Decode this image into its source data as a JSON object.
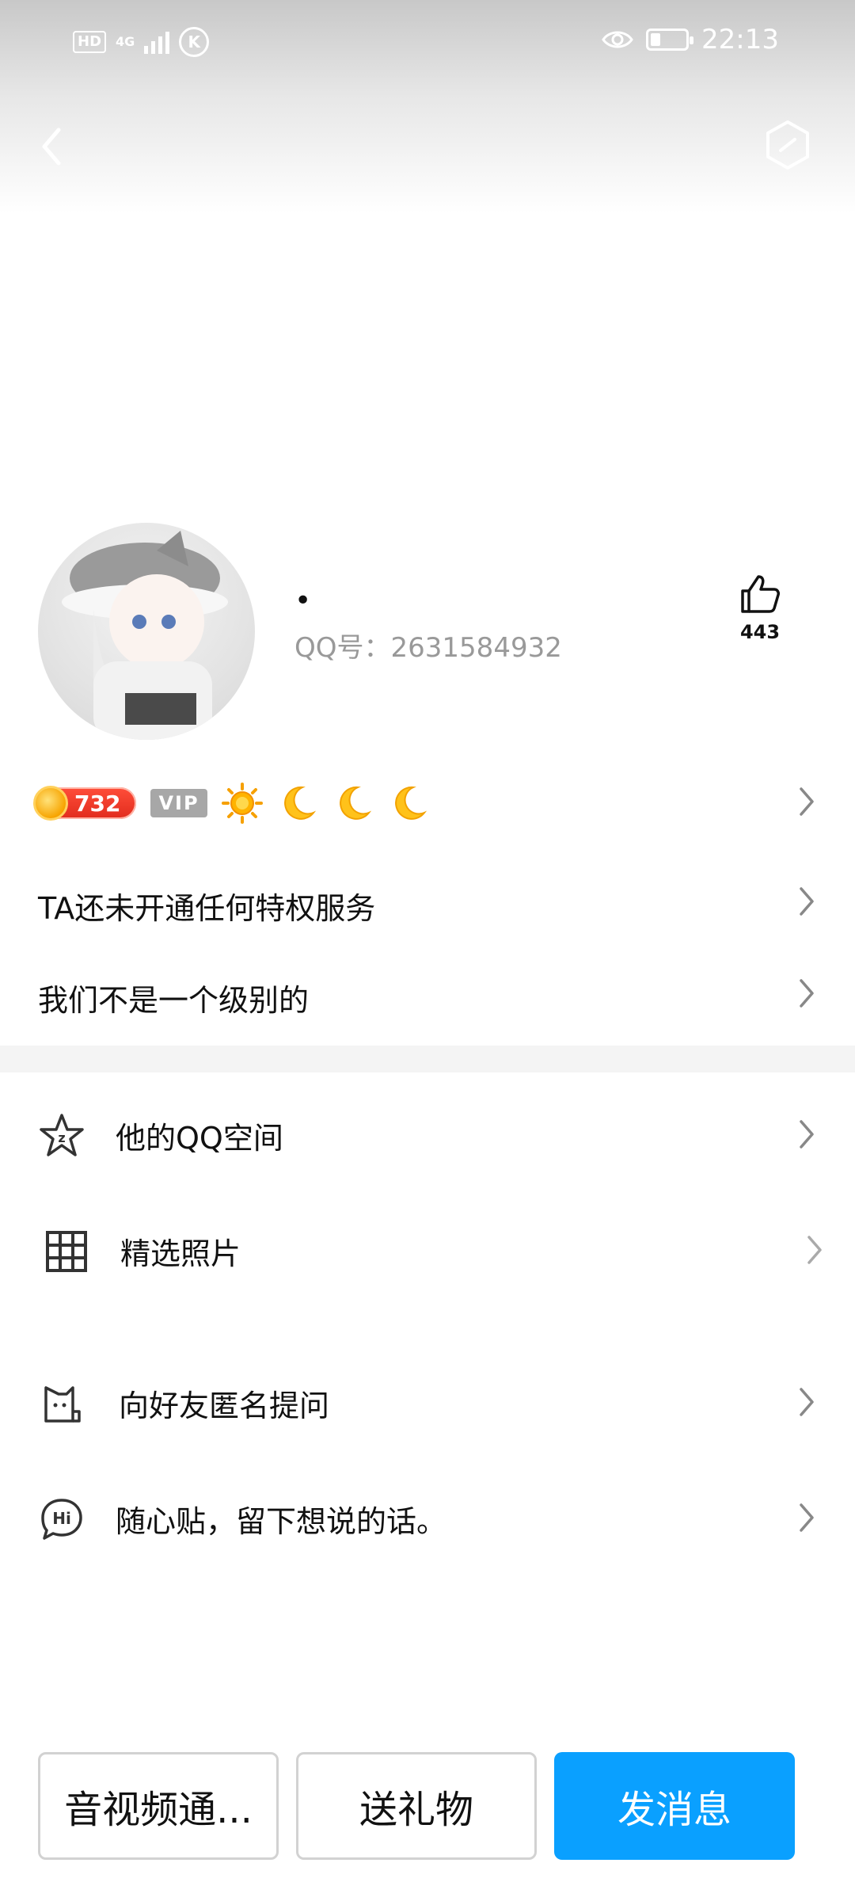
{
  "status_bar": {
    "left_badges": [
      "HD",
      "4G"
    ],
    "k_icon_label": "K",
    "time": "22:13"
  },
  "profile": {
    "nickname": "•",
    "qq_number": "QQ号：2631584932",
    "likes": "443",
    "level": "732",
    "vip_label": "VIP",
    "level_icons": [
      "sun-icon",
      "moon-icon",
      "moon-icon",
      "moon-icon"
    ]
  },
  "rows": {
    "privilege": "TA还未开通任何特权服务",
    "level_compare": "我们不是一个级别的"
  },
  "list": [
    {
      "label": "他的QQ空间",
      "icon": "qzone-star-icon"
    },
    {
      "label": "精选照片",
      "icon": "grid-icon"
    },
    {
      "label": "向好友匿名提问",
      "icon": "cat-box-icon"
    },
    {
      "label": "随心贴，留下想说的话。",
      "icon": "hi-bubble-icon"
    }
  ],
  "buttons": {
    "call": "音视频通...",
    "gift": "送礼物",
    "message": "发消息"
  },
  "colors": {
    "primary": "#0aa0ff",
    "level_pill": "#e12c1d",
    "divider": "#f4f4f4",
    "muted_text": "#999999"
  }
}
